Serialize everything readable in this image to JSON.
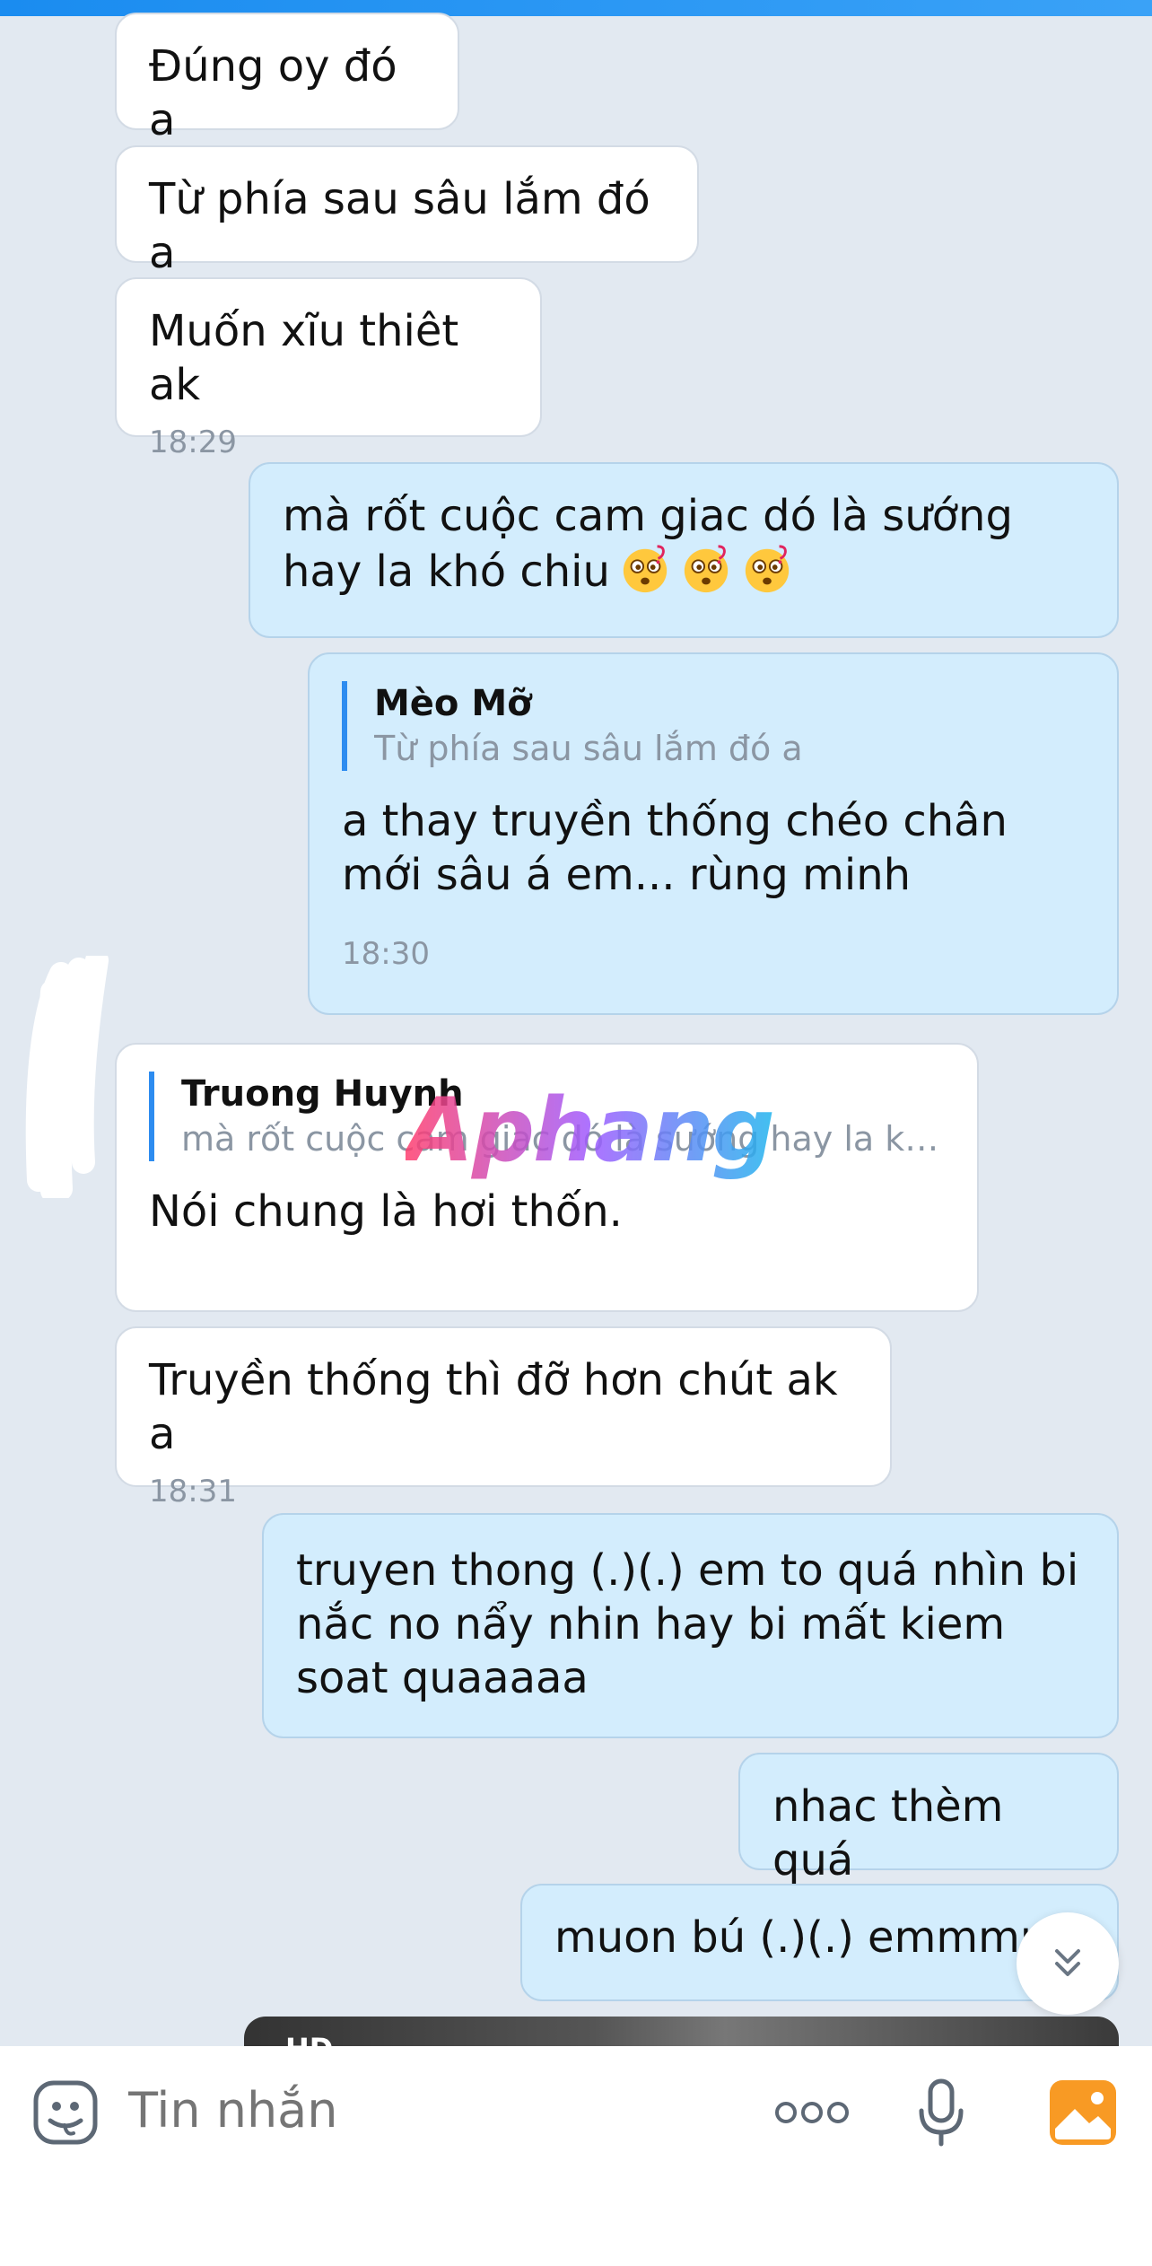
{
  "messages": [
    {
      "dir": "in",
      "text": "Đúng oy đó a"
    },
    {
      "dir": "in",
      "text": "Từ phía sau sâu lắm đó a"
    },
    {
      "dir": "in",
      "text": "Muốn xĩu thiêt ak",
      "time": "18:29"
    },
    {
      "dir": "out",
      "text": "mà rốt cuộc cam giac dó là sướng hay la khó chiu",
      "emojis": [
        "dizzy-face-emoji",
        "dizzy-face-emoji",
        "dizzy-face-emoji"
      ]
    },
    {
      "dir": "out",
      "reply_to": {
        "name": "Mèo Mỡ",
        "text": "Từ phía sau sâu lắm đó a"
      },
      "text": "a thay truyền thống chéo chân mới sâu á em... rùng minh",
      "time": "18:30"
    },
    {
      "dir": "in",
      "reply_to": {
        "name": "Truong Huynh",
        "text": "mà rốt cuộc cam giac dó là sướng hay la kh..."
      },
      "text": "Nói chung là hơi thốn."
    },
    {
      "dir": "in",
      "text": "Truyền thống thì đỡ hơn chút ak a",
      "time": "18:31"
    },
    {
      "dir": "out",
      "text": "truyen thong (.)(.) em to quá nhìn bi nắc no nẩy nhin hay bi mất kiem soat quaaaaa"
    },
    {
      "dir": "out",
      "text": "nhac thèm quá"
    },
    {
      "dir": "out",
      "text": "muon bú (.)(.) emmmm"
    }
  ],
  "media_peek_label": "HD",
  "watermark": "Aphang",
  "composer": {
    "placeholder": "Tin nhắn",
    "icons": [
      "sticker-icon",
      "more-icon",
      "microphone-icon",
      "gallery-icon"
    ]
  },
  "colors": {
    "background": "#e2e9f1",
    "incoming_bubble": "#ffffff",
    "outgoing_bubble": "#d3edfd",
    "reply_bar": "#2d8cf0",
    "time_text": "#8b96a3",
    "gallery_icon": "#f89a24"
  }
}
